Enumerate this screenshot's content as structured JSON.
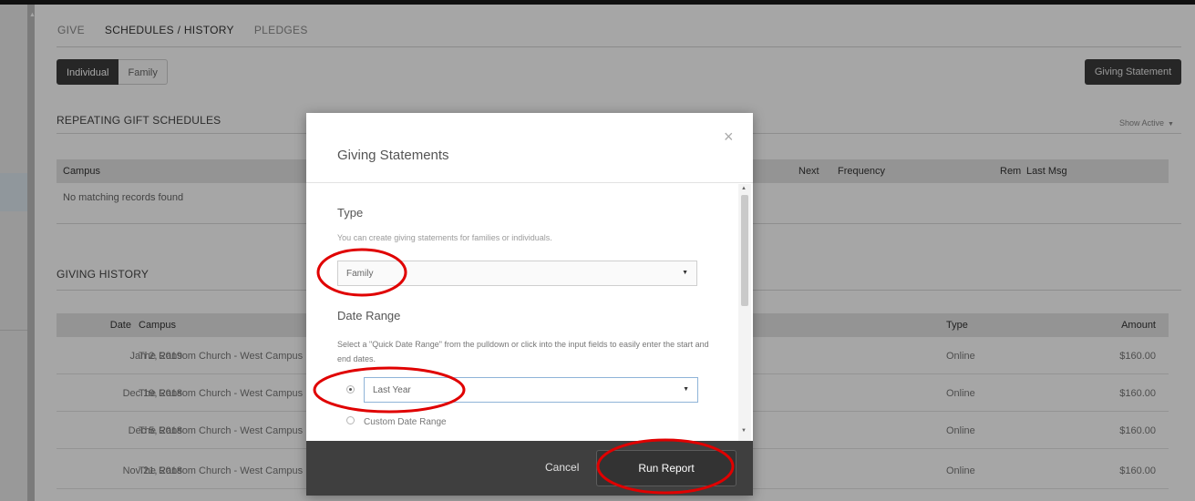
{
  "tabs": [
    {
      "label": "GIVE",
      "active": false
    },
    {
      "label": "SCHEDULES / HISTORY",
      "active": true
    },
    {
      "label": "PLEDGES",
      "active": false
    }
  ],
  "segment": {
    "individual": "Individual",
    "family": "Family"
  },
  "giving_statement_button": "Giving Statement",
  "repeating": {
    "title": "REPEATING GIFT SCHEDULES",
    "show_active": "Show Active",
    "columns": {
      "campus": "Campus",
      "next": "Next",
      "frequency": "Frequency",
      "rem": "Rem",
      "last_msg": "Last Msg"
    },
    "empty": "No matching records found"
  },
  "history": {
    "title": "GIVING HISTORY",
    "columns": {
      "date": "Date",
      "campus": "Campus",
      "type": "Type",
      "amount": "Amount"
    },
    "rows": [
      {
        "date": "Jan 2, 2019",
        "campus": "The Ransom Church - West Campus",
        "type": "Online",
        "amount": "$160.00"
      },
      {
        "date": "Dec 19, 2018",
        "campus": "The Ransom Church - West Campus",
        "type": "Online",
        "amount": "$160.00"
      },
      {
        "date": "Dec 5, 2018",
        "campus": "The Ransom Church - West Campus",
        "type": "Online",
        "amount": "$160.00"
      },
      {
        "date": "Nov 21, 2018",
        "campus": "The Ransom Church - West Campus",
        "type": "Online",
        "amount": "$160.00"
      }
    ]
  },
  "modal": {
    "title": "Giving Statements",
    "close": "×",
    "type_heading": "Type",
    "type_help": "You can create giving statements for families or individuals.",
    "type_value": "Family",
    "date_heading": "Date Range",
    "date_help": "Select a \"Quick Date Range\" from the pulldown or click into the input fields to easily enter the start and end dates.",
    "quick_range_value": "Last Year",
    "custom_range_label": "Custom Date Range",
    "cancel": "Cancel",
    "run_report": "Run Report"
  },
  "icons": {
    "close": "close-icon",
    "caret": "caret-down-icon",
    "radio": "radio-icon"
  },
  "colors": {
    "annotation": "#e00000",
    "dark_button": "#3b3b3b",
    "footer": "#3f3f3f"
  }
}
